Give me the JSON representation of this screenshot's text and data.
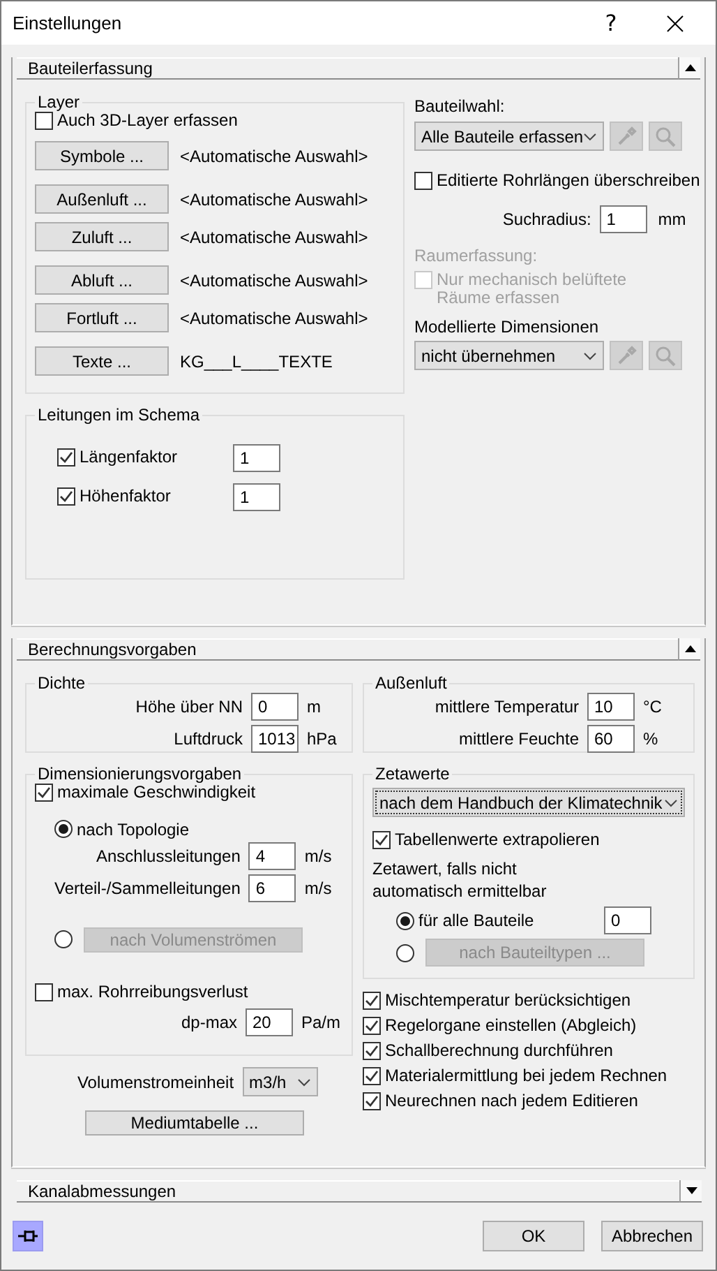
{
  "window": {
    "title": "Einstellungen",
    "help": "?"
  },
  "sections": [
    {
      "title": "Bauteilerfassung",
      "expanded": true
    },
    {
      "title": "Berechnungsvorgaben",
      "expanded": true
    },
    {
      "title": "Kanalabmessungen",
      "expanded": false
    }
  ],
  "bauteilerfassung": {
    "layer": {
      "title": "Layer",
      "also_3d": {
        "label": "Auch 3D-Layer erfassen",
        "checked": false
      },
      "rows": [
        {
          "button": "Symbole ...",
          "value": "<Automatische Auswahl>"
        },
        {
          "button": "Außenluft ...",
          "value": "<Automatische Auswahl>"
        },
        {
          "button": "Zuluft ...",
          "value": "<Automatische Auswahl>"
        },
        {
          "button": "Abluft ...",
          "value": "<Automatische Auswahl>"
        },
        {
          "button": "Fortluft ...",
          "value": "<Automatische Auswahl>"
        },
        {
          "button": "Texte ...",
          "value": "KG___L____TEXTE"
        }
      ]
    },
    "leitungen": {
      "title": "Leitungen im Schema",
      "rows": [
        {
          "label": "Längenfaktor",
          "checked": true,
          "value": "1"
        },
        {
          "label": "Höhenfaktor",
          "checked": true,
          "value": "1"
        }
      ]
    },
    "bauteilwahl": {
      "label": "Bauteilwahl:",
      "value": "Alle Bauteile erfassen"
    },
    "rohrlaengen": {
      "label": "Editierte Rohrlängen überschreiben",
      "checked": false
    },
    "suchradius": {
      "label": "Suchradius:",
      "value": "1",
      "unit": "mm"
    },
    "raumerfassung": {
      "label": "Raumerfassung:",
      "disabled": true,
      "option": {
        "label": "Nur mechanisch belüftete Räume erfassen",
        "checked": false
      }
    },
    "dimensionen": {
      "label": "Modellierte Dimensionen",
      "value": "nicht übernehmen"
    }
  },
  "berechnungsvorgaben": {
    "dichte": {
      "title": "Dichte",
      "fields": [
        {
          "label": "Höhe über NN",
          "value": "0",
          "unit": "m"
        },
        {
          "label": "Luftdruck",
          "value": "1013",
          "unit": "hPa"
        }
      ]
    },
    "aussenluft": {
      "title": "Außenluft",
      "fields": [
        {
          "label": "mittlere Temperatur",
          "value": "10",
          "unit": "°C"
        },
        {
          "label": "mittlere Feuchte",
          "value": "60",
          "unit": "%"
        }
      ]
    },
    "dimensionierung": {
      "title": "Dimensionierungsvorgaben",
      "max_speed": {
        "label": "maximale Geschwindigkeit",
        "checked": true
      },
      "modes": [
        {
          "kind": "label",
          "label": "nach Topologie",
          "selected": true,
          "disabled": false
        },
        {
          "kind": "button",
          "label": "nach Volumenströmen",
          "selected": false,
          "disabled": true
        }
      ],
      "fields": [
        {
          "label": "Anschlussleitungen",
          "value": "4",
          "unit": "m/s"
        },
        {
          "label": "Verteil-/Sammelleitungen",
          "value": "6",
          "unit": "m/s"
        }
      ],
      "friction": {
        "label": "max. Rohrreibungsverlust",
        "checked": false
      },
      "dp_max": {
        "label": "dp-max",
        "value": "20",
        "unit": "Pa/m"
      }
    },
    "volumenstromeinheit": {
      "label": "Volumenstromeinheit",
      "value": "m3/h"
    },
    "mediumtabelle": "Mediumtabelle ...",
    "zetawerte": {
      "title": "Zetawerte",
      "method": "nach dem Handbuch der Klimatechnik",
      "extrapolate": {
        "label": "Tabellenwerte extrapolieren",
        "checked": true
      },
      "note": "Zetawert, falls nicht automatisch ermittelbar",
      "modes": [
        {
          "kind": "label",
          "label": "für alle Bauteile",
          "selected": true,
          "disabled": false,
          "value": "0"
        },
        {
          "kind": "button",
          "label": "nach Bauteiltypen ...",
          "selected": false,
          "disabled": true
        }
      ]
    },
    "options": [
      {
        "label": "Mischtemperatur berücksichtigen",
        "checked": true
      },
      {
        "label": "Regelorgane einstellen (Abgleich)",
        "checked": true
      },
      {
        "label": "Schallberechnung durchführen",
        "checked": true
      },
      {
        "label": "Materialermittlung bei jedem Rechnen",
        "checked": true
      },
      {
        "label": "Neurechnen nach jedem Editieren",
        "checked": true
      }
    ]
  },
  "footer": {
    "ok": "OK",
    "cancel": "Abbrechen"
  }
}
